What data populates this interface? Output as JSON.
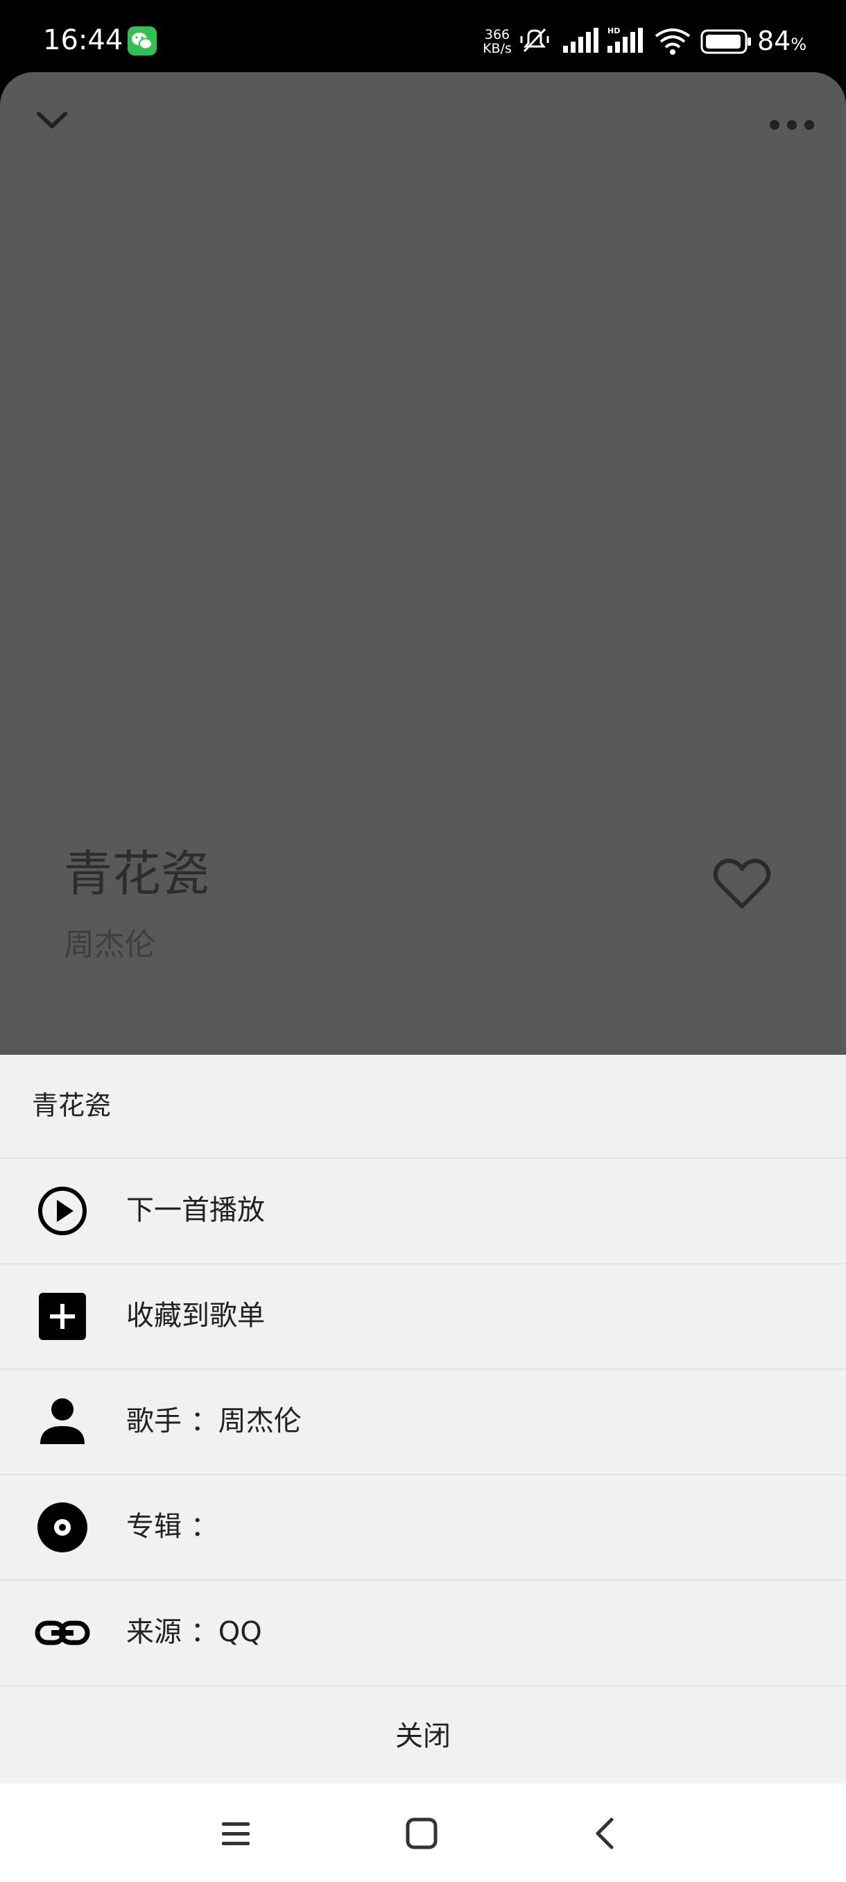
{
  "status_bar": {
    "time": "16:44",
    "net_speed_value": "366",
    "net_speed_unit": "KB/s",
    "battery_percent": "84",
    "battery_unit": "%",
    "icons": [
      "wechat-icon",
      "mute-icon",
      "signal-icon",
      "hd-signal-icon",
      "wifi-icon",
      "battery-icon"
    ]
  },
  "player": {
    "title": "青花瓷",
    "artist": "周杰伦",
    "icons": [
      "chevron-down-icon",
      "more-icon",
      "heart-icon"
    ]
  },
  "sheet": {
    "title": "青花瓷",
    "items": [
      {
        "icon": "play-circle-icon",
        "label": "下一首播放"
      },
      {
        "icon": "plus-square-icon",
        "label": "收藏到歌单"
      },
      {
        "icon": "person-icon",
        "label": "歌手 ：周杰伦"
      },
      {
        "icon": "album-disc-icon",
        "label": "专辑 ："
      },
      {
        "icon": "link-icon",
        "label": "来源 ：QQ"
      }
    ],
    "close_label": "关闭"
  },
  "nav_bar": {
    "icons": [
      "menu-icon",
      "home-square-icon",
      "back-chevron-icon"
    ]
  },
  "colors": {
    "player_bg": "#595959",
    "sheet_bg": "#f1f1f1",
    "divider": "#e2e2e2",
    "text": "#222222"
  }
}
